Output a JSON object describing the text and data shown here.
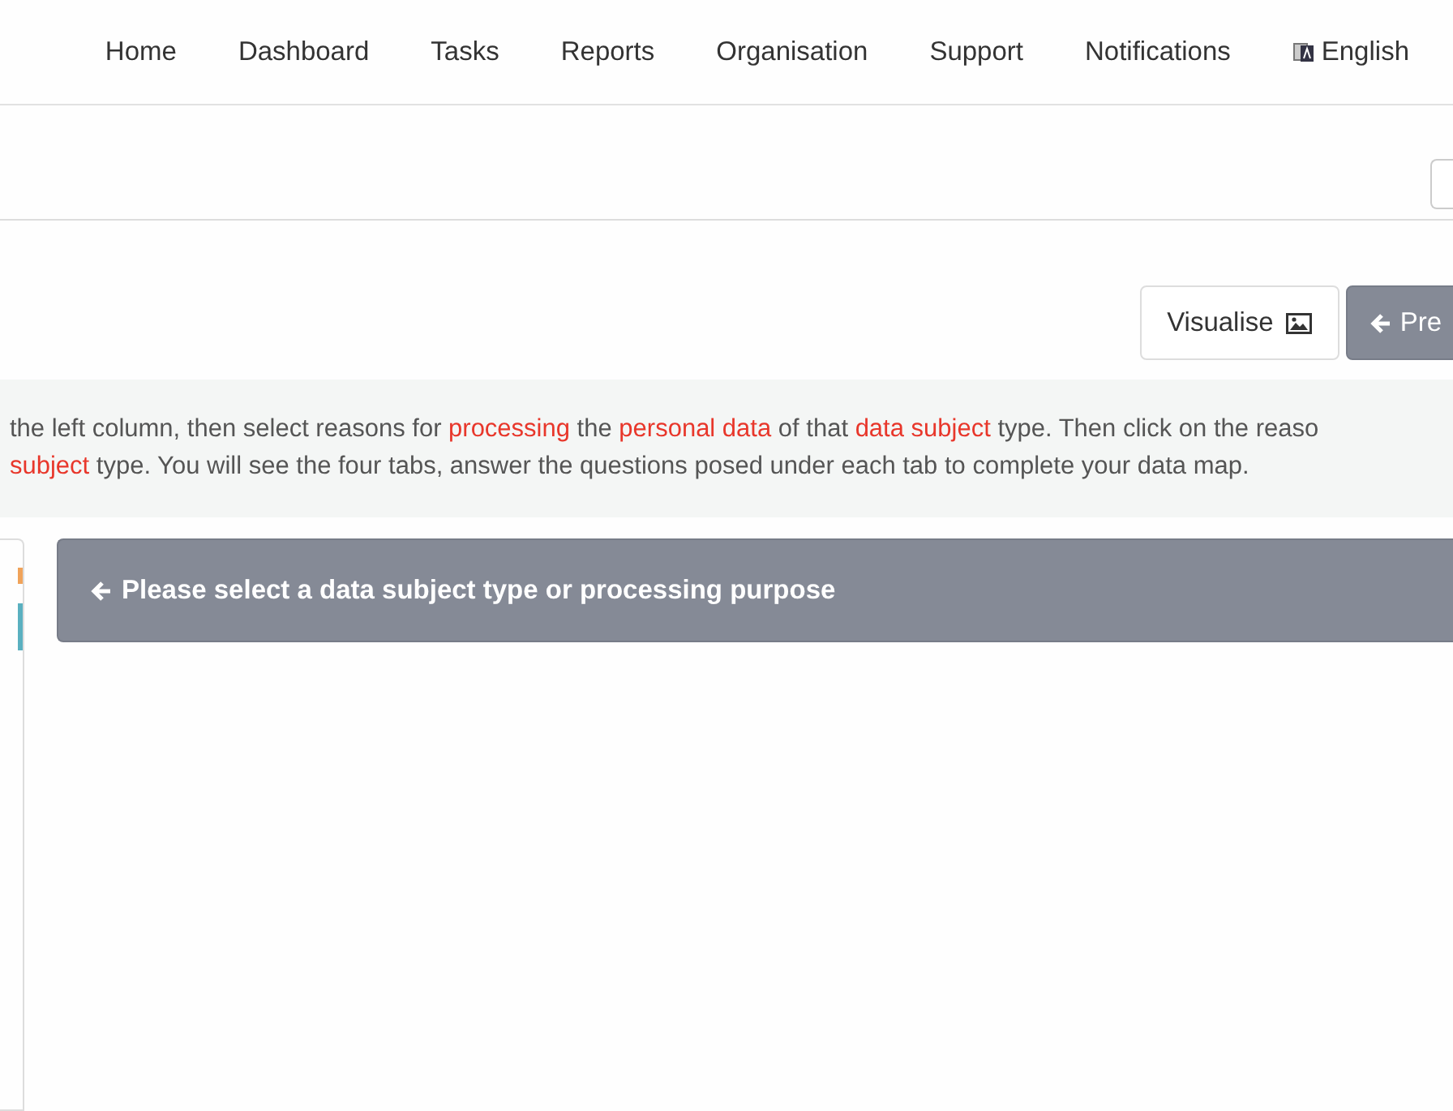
{
  "nav": {
    "items": [
      {
        "label": "Home"
      },
      {
        "label": "Dashboard"
      },
      {
        "label": "Tasks"
      },
      {
        "label": "Reports"
      },
      {
        "label": "Organisation"
      },
      {
        "label": "Support"
      },
      {
        "label": "Notifications"
      }
    ],
    "language": "English"
  },
  "actions": {
    "visualise": "Visualise",
    "previous": "Pre"
  },
  "instructions": [
    [
      {
        "text": "the left column, then select reasons for ",
        "highlight": false
      },
      {
        "text": "processing",
        "highlight": true
      },
      {
        "text": " the ",
        "highlight": false
      },
      {
        "text": "personal data",
        "highlight": true
      },
      {
        "text": " of that ",
        "highlight": false
      },
      {
        "text": "data subject",
        "highlight": true
      },
      {
        "text": " type. Then click on the reaso",
        "highlight": false
      }
    ],
    [
      {
        "text": "subject",
        "highlight": true
      },
      {
        "text": " type. You will see the four tabs, answer the questions posed under each tab to complete your data map.",
        "highlight": false
      }
    ]
  ],
  "notice": "Please select a data subject type or processing purpose"
}
